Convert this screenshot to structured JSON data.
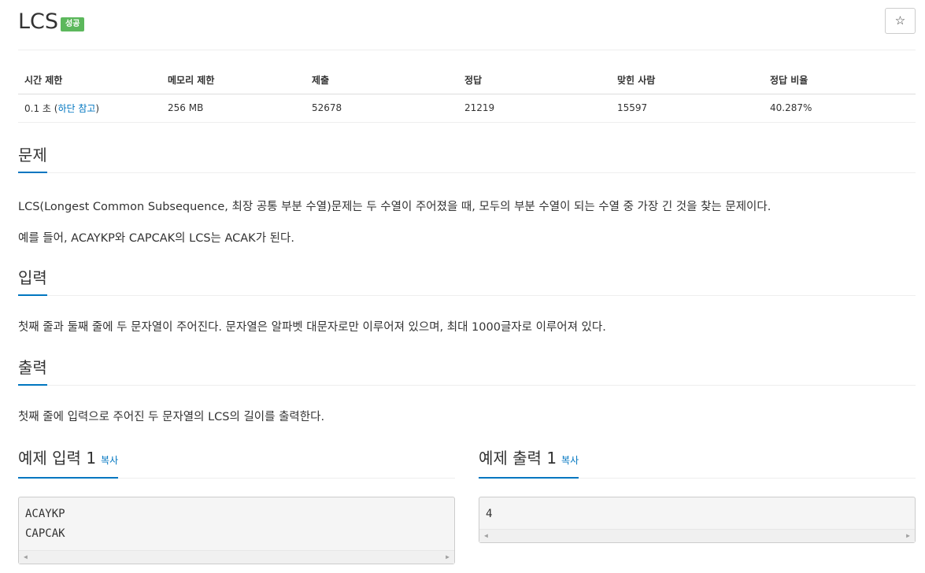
{
  "problem": {
    "title": "LCS",
    "badge": "성공",
    "star": "☆"
  },
  "stats": {
    "headers": [
      "시간 제한",
      "메모리 제한",
      "제출",
      "정답",
      "맞힌 사람",
      "정답 비율"
    ],
    "time_value": "0.1 초 (",
    "time_link": "하단 참고",
    "time_close": ")",
    "memory": "256 MB",
    "submissions": "52678",
    "accepted": "21219",
    "solved_users": "15597",
    "ratio": "40.287%"
  },
  "sections": {
    "problem_title": "문제",
    "problem_p1": "LCS(Longest Common Subsequence, 최장 공통 부분 수열)문제는 두 수열이 주어졌을 때, 모두의 부분 수열이 되는 수열 중 가장 긴 것을 찾는 문제이다.",
    "problem_p2": "예를 들어, ACAYKP와 CAPCAK의 LCS는 ACAK가 된다.",
    "input_title": "입력",
    "input_p": "첫째 줄과 둘째 줄에 두 문자열이 주어진다. 문자열은 알파벳 대문자로만 이루어져 있으며, 최대 1000글자로 이루어져 있다.",
    "output_title": "출력",
    "output_p": "첫째 줄에 입력으로 주어진 두 문자열의 LCS의 길이를 출력한다."
  },
  "samples": {
    "input_title": "예제 입력 1",
    "output_title": "예제 출력 1",
    "copy_label": "복사",
    "input_lines": [
      "ACAYKP",
      "CAPCAK"
    ],
    "output_lines": [
      "4"
    ]
  }
}
